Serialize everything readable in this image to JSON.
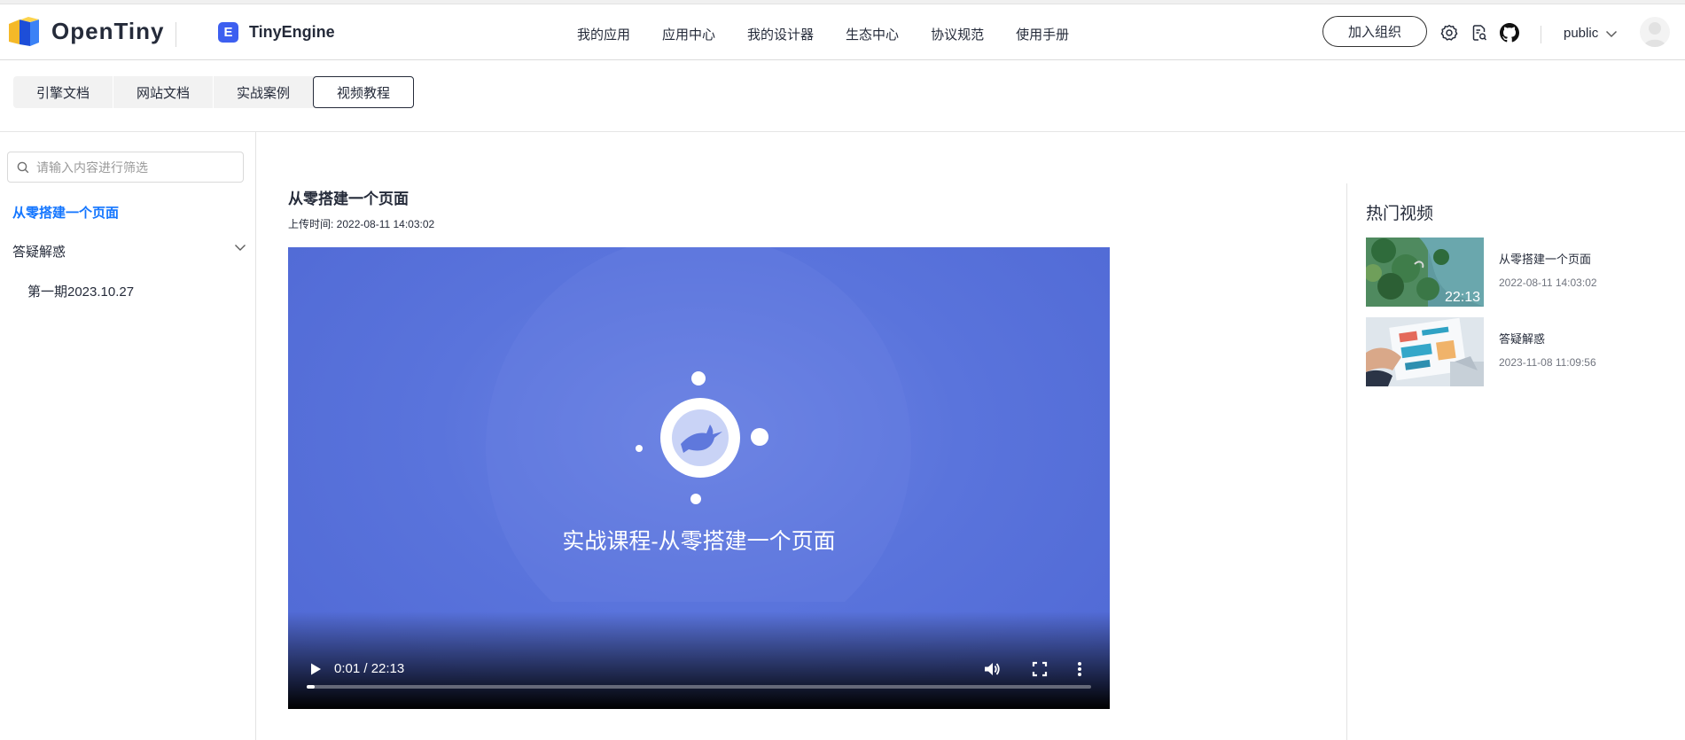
{
  "header": {
    "logo_text": "OpenTiny",
    "engine_badge": "E",
    "engine_text": "TinyEngine",
    "nav": [
      "我的应用",
      "应用中心",
      "我的设计器",
      "生态中心",
      "协议规范",
      "使用手册"
    ],
    "join_label": "加入组织",
    "account": "public"
  },
  "tabs": [
    {
      "label": "引擎文档",
      "active": false
    },
    {
      "label": "网站文档",
      "active": false
    },
    {
      "label": "实战案例",
      "active": false
    },
    {
      "label": "视频教程",
      "active": true
    }
  ],
  "sidebar": {
    "search_placeholder": "请输入内容进行筛选",
    "items": [
      {
        "label": "从零搭建一个页面",
        "active": true
      },
      {
        "label": "答疑解惑",
        "expanded": true,
        "children": [
          {
            "label": "第一期2023.10.27"
          }
        ]
      }
    ]
  },
  "main": {
    "title": "从零搭建一个页面",
    "upload": "上传时间: 2022-08-11 14:03:02",
    "video": {
      "caption": "实战课程-从零搭建一个页面",
      "time": "0:01 / 22:13",
      "progress": 0.01
    }
  },
  "hot": {
    "title": "热门视频",
    "items": [
      {
        "title": "从零搭建一个页面",
        "date": "2022-08-11 14:03:02",
        "duration": "22:13"
      },
      {
        "title": "答疑解惑",
        "date": "2023-11-08 11:09:56",
        "duration": ""
      }
    ]
  },
  "colors": {
    "accent": "#1476ff",
    "video_bg": "#5a74dc",
    "engine": "#3d5ff0"
  }
}
